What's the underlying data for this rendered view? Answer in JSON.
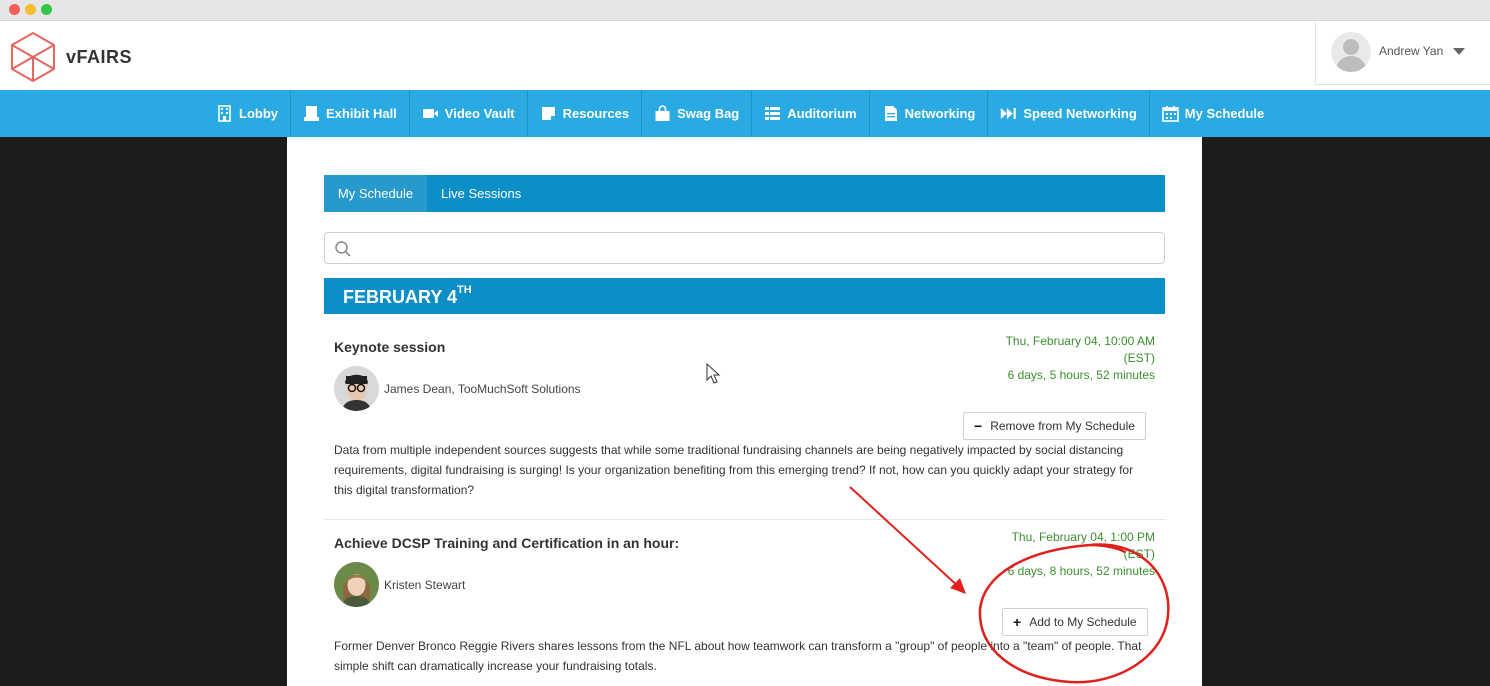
{
  "window": {
    "controls": [
      "close",
      "minimize",
      "maximize"
    ]
  },
  "header": {
    "logo_text": "vFAIRS",
    "logo_icon": "cube-outline-icon",
    "user_name": "Andrew Yan"
  },
  "nav": {
    "items": [
      {
        "label": "Lobby",
        "icon": "building-icon"
      },
      {
        "label": "Exhibit Hall",
        "icon": "booth-icon"
      },
      {
        "label": "Video Vault",
        "icon": "video-camera-icon"
      },
      {
        "label": "Resources",
        "icon": "document-icon"
      },
      {
        "label": "Swag Bag",
        "icon": "bag-icon"
      },
      {
        "label": "Auditorium",
        "icon": "list-icon"
      },
      {
        "label": "Networking",
        "icon": "file-icon"
      },
      {
        "label": "Speed Networking",
        "icon": "fast-forward-icon"
      },
      {
        "label": "My Schedule",
        "icon": "calendar-icon"
      }
    ],
    "color": "#2aaae2"
  },
  "tabs": {
    "my_schedule": "My Schedule",
    "live_sessions": "Live Sessions"
  },
  "search": {
    "placeholder": ""
  },
  "date_header": {
    "text": "FEBRUARY 4",
    "suffix": "TH"
  },
  "sessions": [
    {
      "title": "Keynote session",
      "speaker": "James Dean, TooMuchSoft Solutions",
      "time_line1": "Thu, February 04, 10:00 AM",
      "time_line2": "(EST)",
      "countdown": "6 days, 5 hours, 52 minutes",
      "button_label": "Remove from My Schedule",
      "button_icon": "−",
      "description": "Data from multiple independent sources suggests that while some traditional fundraising channels are being negatively impacted by social distancing requirements, digital fundraising is surging!  Is your organization benefiting from this emerging trend?  If not, how can you quickly adapt your strategy for this digital transformation?"
    },
    {
      "title": "Achieve DCSP Training and Certification in an hour:",
      "speaker": "Kristen Stewart",
      "time_line1": "Thu, February 04, 1:00 PM",
      "time_line2": "(EST)",
      "countdown": "6 days, 8 hours, 52 minutes",
      "button_label": "Add to My Schedule",
      "button_icon": "+",
      "description": "Former Denver Bronco Reggie Rivers shares lessons from the NFL about how teamwork can transform a \"group\" of people into a \"team\" of people. That simple shift can dramatically increase your fundraising totals."
    }
  ],
  "colors": {
    "accent": "#0b8fc6",
    "time_green": "#3a8f2c",
    "annotation": "#e0201c"
  }
}
